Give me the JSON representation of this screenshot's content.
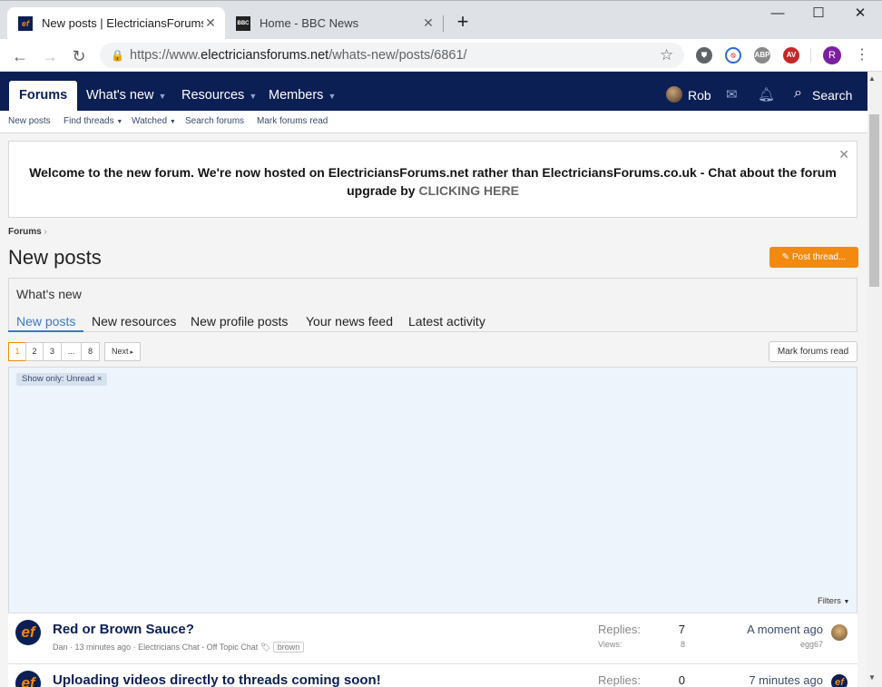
{
  "browser": {
    "tabs": [
      {
        "title": "New posts | ElectriciansForums.net",
        "favicon": "ef"
      },
      {
        "title": "Home - BBC News",
        "favicon": "BBC"
      }
    ],
    "url_scheme": "https://www.",
    "url_host": "electriciansforums.net",
    "url_path": "/whats-new/posts/6861/",
    "profile_initial": "R"
  },
  "site_nav": {
    "items": [
      "Forums",
      "What's new",
      "Resources",
      "Members"
    ],
    "user": "Rob",
    "search": "Search"
  },
  "subnav": {
    "items": [
      "New posts",
      "Find threads",
      "Watched",
      "Search forums",
      "Mark forums read"
    ]
  },
  "notice": {
    "text": "Welcome to the new forum. We're now hosted on ElectriciansForums.net rather than ElectriciansForums.co.uk - Chat about the forum upgrade by",
    "link": "CLICKING HERE"
  },
  "breadcrumb": "Forums",
  "page_title": "New posts",
  "post_thread_label": "Post thread...",
  "whats_new": {
    "title": "What's new",
    "tabs": [
      "New posts",
      "New resources",
      "New profile posts",
      "Your news feed",
      "Latest activity"
    ]
  },
  "pagination": {
    "pages": [
      "1",
      "2",
      "3",
      "...",
      "8"
    ],
    "next": "Next"
  },
  "mark_read_label": "Mark forums read",
  "filter_chip": "Show only: Unread",
  "filters_label": "Filters",
  "threads": [
    {
      "title": "Red or Brown Sauce?",
      "author": "Dan",
      "time": "13 minutes ago",
      "forum": "Electricians Chat - Off Topic Chat",
      "tag": "brown",
      "replies_label": "Replies:",
      "replies": "7",
      "views_label": "Views:",
      "views": "8",
      "last": "A moment ago",
      "last_user": "egg67"
    },
    {
      "title": "Uploading videos directly to threads coming soon!",
      "replies_label": "Replies:",
      "replies": "0",
      "last": "7 minutes ago"
    }
  ]
}
